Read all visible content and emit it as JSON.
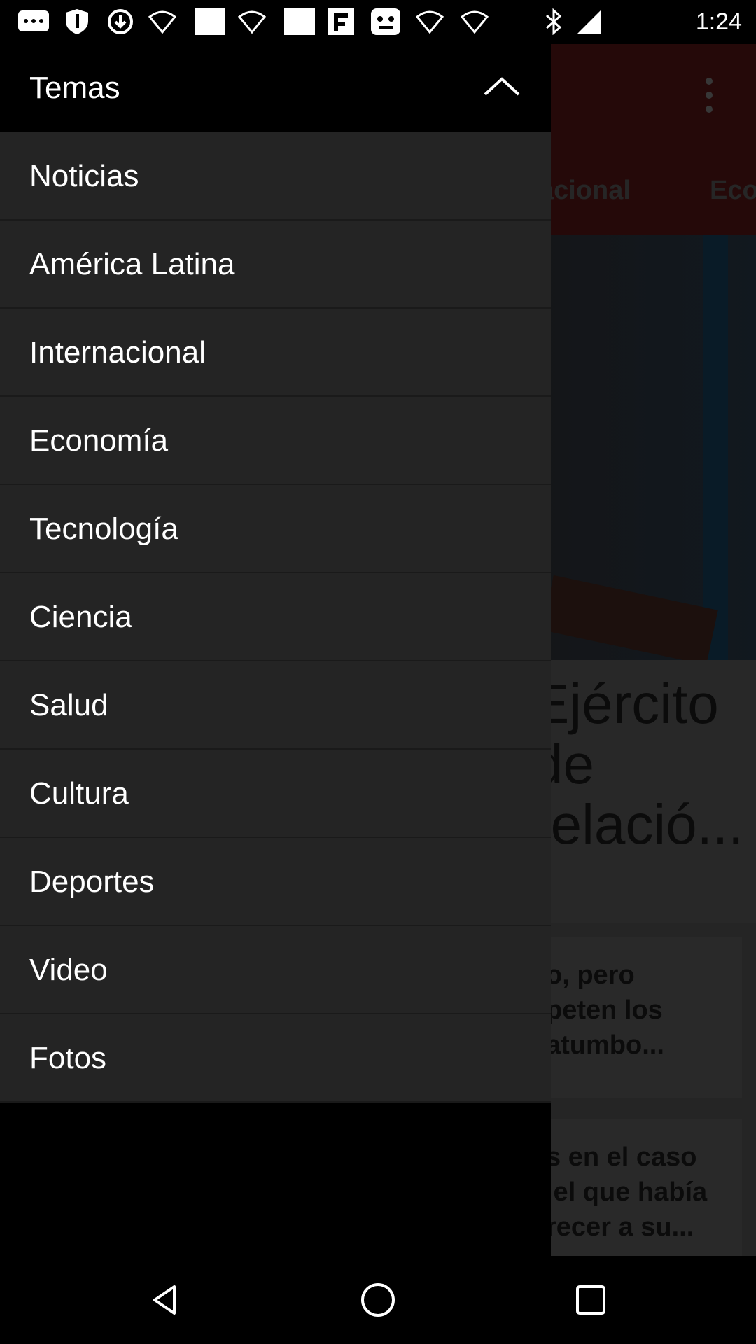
{
  "status_bar": {
    "time": "1:24",
    "icons": [
      "messages-icon",
      "shield-icon",
      "download-icon",
      "wifi-icon",
      "blank-image-icon",
      "wifi-icon",
      "blank-image-icon",
      "flipboard-icon",
      "app-icon",
      "wifi-icon",
      "wifi-icon",
      "bluetooth-icon",
      "signal-icon"
    ]
  },
  "app": {
    "tabs_partial": [
      "acional",
      "Eco"
    ],
    "headline_partial": "Ejército\nde\nrelació...",
    "card1_partial": "o, pero\npeten los\natumbo...",
    "card2_partial": "s en el caso\n el que había\nrecer a su..."
  },
  "drawer": {
    "title": "Temas",
    "items": [
      {
        "label": "Noticias"
      },
      {
        "label": "América Latina"
      },
      {
        "label": "Internacional"
      },
      {
        "label": "Economía"
      },
      {
        "label": "Tecnología"
      },
      {
        "label": "Ciencia"
      },
      {
        "label": "Salud"
      },
      {
        "label": "Cultura"
      },
      {
        "label": "Deportes"
      },
      {
        "label": "Video"
      },
      {
        "label": "Fotos"
      }
    ]
  },
  "colors": {
    "drawer_bg": "#242424",
    "drawer_header_bg": "#000000",
    "toolbar_bg": "#3a0e0e",
    "text": "#ffffff"
  }
}
